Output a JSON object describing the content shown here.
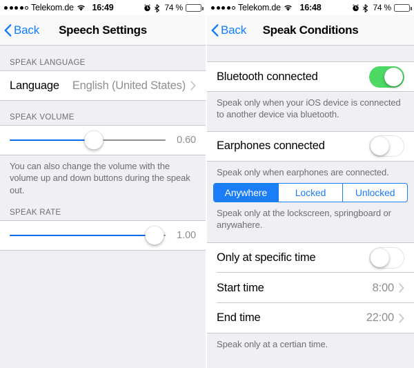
{
  "left": {
    "statusbar": {
      "carrier": "Telekom.de",
      "time": "16:49",
      "battery_pct": "74 %",
      "signal_dots_filled": 4,
      "signal_dots_total": 5,
      "wifi_icon": "wifi-icon",
      "alarm_icon": "alarm-clock-icon",
      "bluetooth_icon": "bluetooth-icon",
      "battery_icon": "battery-icon"
    },
    "nav": {
      "back_label": "Back",
      "title": "Speech Settings",
      "back_icon": "chevron-left-icon"
    },
    "sections": {
      "language": {
        "header": "SPEAK LANGUAGE",
        "row_label": "Language",
        "row_value": "English (United States)",
        "disclosure_icon": "chevron-right-icon"
      },
      "volume": {
        "header": "SPEAK VOLUME",
        "value": "0.60",
        "fill_percent": 54,
        "footnote": "You can also change the volume with the volume up and down buttons during the speak out."
      },
      "rate": {
        "header": "SPEAK RATE",
        "value": "1.00",
        "fill_percent": 93
      }
    }
  },
  "right": {
    "statusbar": {
      "carrier": "Telekom.de",
      "time": "16:48",
      "battery_pct": "74 %",
      "signal_dots_filled": 4,
      "signal_dots_total": 5,
      "wifi_icon": "wifi-icon",
      "alarm_icon": "alarm-clock-icon",
      "bluetooth_icon": "bluetooth-icon",
      "battery_icon": "battery-icon"
    },
    "nav": {
      "back_label": "Back",
      "title": "Speak Conditions",
      "back_icon": "chevron-left-icon"
    },
    "bluetooth": {
      "label": "Bluetooth connected",
      "state": "on",
      "footnote": "Speak only when your iOS device is connected to another device via bluetooth."
    },
    "earphones": {
      "label": "Earphones connected",
      "state": "off",
      "footnote": "Speak only when earphones are connected."
    },
    "lockstate": {
      "options": [
        "Anywhere",
        "Locked",
        "Unlocked"
      ],
      "selected_index": 0,
      "footnote": "Speak only at the lockscreen, springboard or anywahere."
    },
    "specific_time": {
      "label": "Only at specific time",
      "state": "off",
      "start_label": "Start time",
      "start_value": "8:00",
      "end_label": "End time",
      "end_value": "22:00",
      "disclosure_icon": "chevron-right-icon",
      "footnote": "Speak only at a certian time."
    }
  },
  "colors": {
    "tint_blue": "#137efb",
    "segment_blue": "#1b7ef7",
    "switch_green": "#4cd964",
    "slider_blue": "#0b6cf0",
    "group_bg": "#efeff4",
    "separator": "#c8c7cc",
    "secondary_text": "#8e8e93"
  }
}
